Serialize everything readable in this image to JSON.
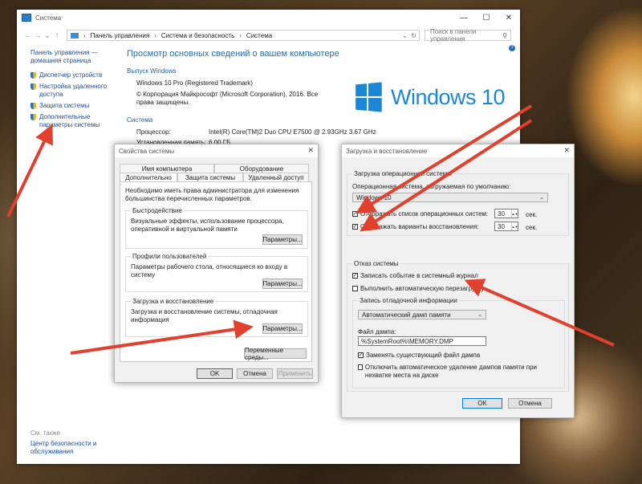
{
  "colors": {
    "accent": "#1987d6",
    "arrow": "#e0402c",
    "link": "#1a4fa0"
  },
  "window": {
    "title": "Система"
  },
  "address": {
    "crumbs": [
      "Панель управления",
      "Система и безопасность",
      "Система"
    ],
    "search_placeholder": "Поиск в панели управления"
  },
  "sidebar": {
    "home": "Панель управления — домашняя страница",
    "items": [
      {
        "label": "Диспетчер устройств"
      },
      {
        "label": "Настройка удаленного доступа"
      },
      {
        "label": "Защита системы"
      },
      {
        "label": "Дополнительные параметры системы"
      }
    ],
    "see_also": "См. также",
    "security_center": "Центр безопасности и обслуживания"
  },
  "main": {
    "heading": "Просмотр основных сведений о вашем компьютере",
    "edition_section": "Выпуск Windows",
    "edition": "Windows 10 Pro (Registered Trademark)",
    "copyright": "© Корпорация Майкрософт (Microsoft Corporation), 2016. Все права защищены.",
    "logo_text": "Windows 10",
    "system_section": "Система",
    "cpu_label": "Процессор:",
    "cpu_value": "Intel(R) Core(TM)2 Duo CPU     E7500  @ 2.93GHz   3.67 GHz",
    "ram_label": "Установленная память:",
    "ram_value": "6,00 ГБ"
  },
  "sysprops": {
    "title": "Свойства системы",
    "tabs_row1": [
      "Имя компьютера",
      "Оборудование"
    ],
    "tabs_row2": [
      "Дополнительно",
      "Защита системы",
      "Удаленный доступ"
    ],
    "admin_note": "Необходимо иметь права администратора для изменения большинства перечисленных параметров.",
    "perf_title": "Быстродействие",
    "perf_desc": "Визуальные эффекты, использование процессора, оперативной и виртуальной памяти",
    "profiles_title": "Профили пользователей",
    "profiles_desc": "Параметры рабочего стола, относящиеся ко входу в систему",
    "startup_title": "Загрузка и восстановление",
    "startup_desc": "Загрузка и восстановление системы, отладочная информация",
    "params_btn": "Параметры...",
    "env_btn": "Переменные среды...",
    "ok": "OK",
    "cancel": "Отмена",
    "apply": "Применить"
  },
  "startup": {
    "title": "Загрузка и восстановление",
    "boot_group": "Загрузка операционной системы",
    "default_os_label": "Операционная система, загружаемая по умолчанию:",
    "default_os_value": "Windows 10",
    "show_list": "Отображать список операционных систем:",
    "show_list_value": "30",
    "show_recovery": "Отображать варианты восстановления:",
    "show_recovery_value": "30",
    "sec": "сек.",
    "failure_group": "Отказ системы",
    "write_event": "Записать событие в системный журнал",
    "auto_restart": "Выполнить автоматическую перезагрузку",
    "debug_group": "Запись отладочной информации",
    "dump_type": "Автоматический дамп памяти",
    "dump_file_label": "Файл дампа:",
    "dump_file": "%SystemRoot%\\MEMORY.DMP",
    "overwrite": "Заменять существующий файл дампа",
    "disable_auto_delete": "Отключить автоматическое удаление дампов памяти при нехватке места на диске",
    "ok": "OK",
    "cancel": "Отмена"
  }
}
